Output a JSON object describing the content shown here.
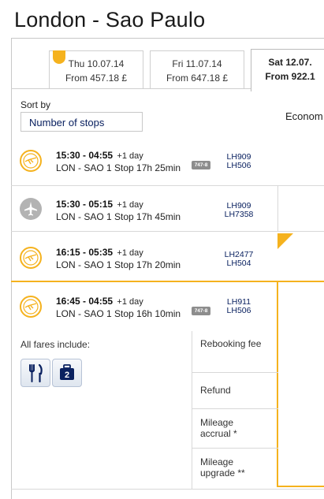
{
  "title": "London - Sao Paulo",
  "date_tabs": [
    {
      "date": "Thu 10.07.14",
      "price": "From 457.18 £"
    },
    {
      "date": "Fri 11.07.14",
      "price": "From 647.18 £"
    },
    {
      "date": "Sat 12.07.",
      "price": "From 922.1"
    }
  ],
  "sort": {
    "label": "Sort by",
    "value": "Number of stops"
  },
  "column_header": "Econom",
  "flights": [
    {
      "time": "15:30 - 04:55",
      "day": "+1 day",
      "route": "LON - SAO  1 Stop  17h 25min",
      "aircraft": "747-8",
      "flight_numbers": [
        "LH909",
        "LH506"
      ],
      "logo": "lufthansa-crane-icon"
    },
    {
      "time": "15:30 - 05:15",
      "day": "+1 day",
      "route": "LON - SAO  1 Stop  17h 45min",
      "aircraft": "",
      "flight_numbers": [
        "LH909",
        "LH7358"
      ],
      "logo": "airplane-icon"
    },
    {
      "time": "16:15 - 05:35",
      "day": "+1 day",
      "route": "LON - SAO  1 Stop  17h 20min",
      "aircraft": "",
      "flight_numbers": [
        "LH2477",
        "LH504"
      ],
      "logo": "lufthansa-crane-icon"
    },
    {
      "time": "16:45 - 04:55",
      "day": "+1 day",
      "route": "LON - SAO  1 Stop  16h 10min",
      "aircraft": "747-8",
      "flight_numbers": [
        "LH911",
        "LH506"
      ],
      "logo": "lufthansa-crane-icon"
    }
  ],
  "fares": {
    "label": "All fares include:",
    "icons": [
      "meal-icon",
      "baggage-icon"
    ],
    "baggage_count": "2",
    "features": [
      "Rebooking fee",
      "Refund",
      "Mileage accrual *",
      "Mileage upgrade **"
    ]
  },
  "colors": {
    "accent": "#f5b21e",
    "link": "#0a2160",
    "border": "#d8d8d8"
  }
}
